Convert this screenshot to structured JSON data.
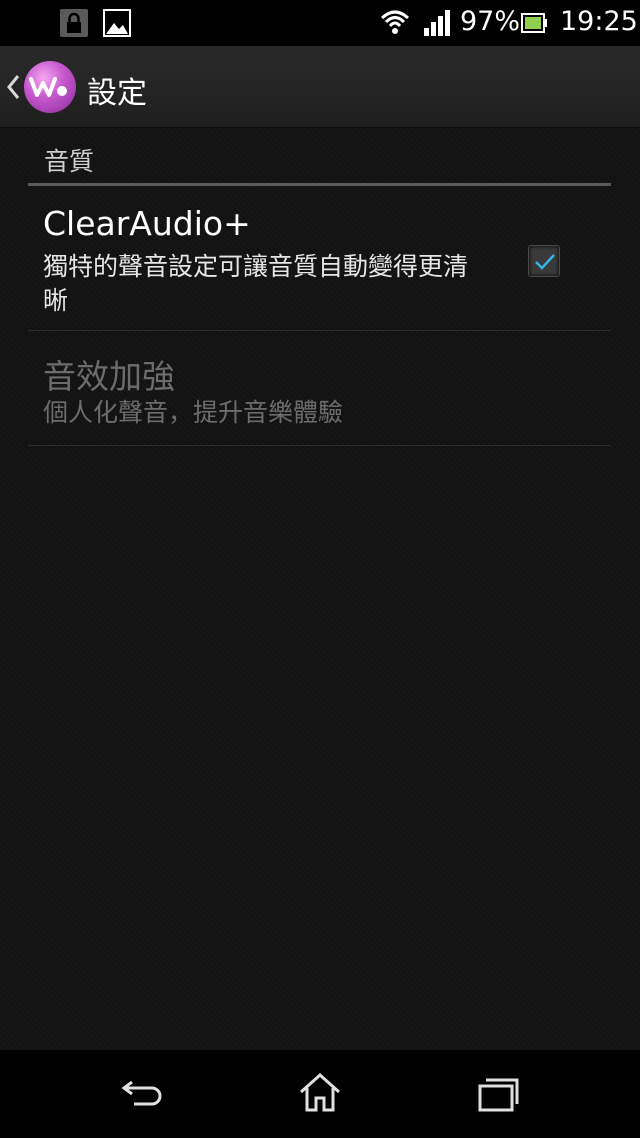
{
  "status_bar": {
    "icons": [
      "lock-icon",
      "image-icon",
      "wifi-icon",
      "signal-icon",
      "battery-icon"
    ],
    "battery_percent": "97%",
    "time": "19:25"
  },
  "action_bar": {
    "title": "設定",
    "logo_icon": "walkman-logo-icon"
  },
  "section": {
    "header": "音質"
  },
  "preferences": [
    {
      "title": "ClearAudio+",
      "summary": "獨特的聲音設定可讓音質自動變得更清晰",
      "checked": true,
      "enabled": true
    },
    {
      "title": "音效加強",
      "summary": "個人化聲音，提升音樂體驗",
      "enabled": false
    }
  ],
  "nav_bar": {
    "icons": [
      "back-icon",
      "home-icon",
      "recent-apps-icon"
    ]
  },
  "colors": {
    "accent": "#33b5e5",
    "background": "#141414",
    "disabled_text": "#6c6c6c"
  }
}
